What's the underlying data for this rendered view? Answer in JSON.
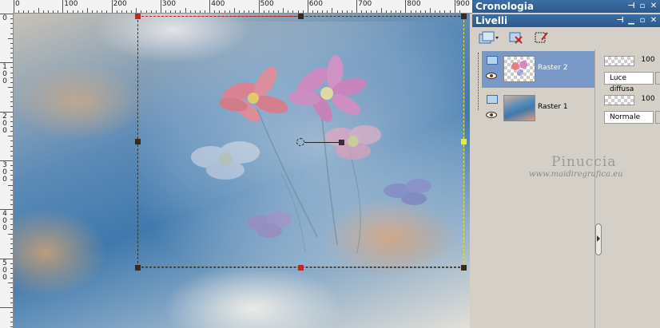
{
  "rulers": {
    "top_labels": [
      "0",
      "100",
      "200",
      "300",
      "400",
      "500",
      "600",
      "700",
      "800",
      "900"
    ],
    "left_labels": [
      [
        "0"
      ],
      [
        "1",
        "0",
        "0"
      ],
      [
        "2",
        "0",
        "0"
      ],
      [
        "3",
        "0",
        "0"
      ],
      [
        "4",
        "0",
        "0"
      ],
      [
        "5",
        "0",
        "0"
      ]
    ]
  },
  "panels": {
    "history_title": "Cronologia",
    "layers_title": "Livelli"
  },
  "layers": [
    {
      "name": "Raster 2",
      "opacity": "100",
      "blend": "Luce diffusa",
      "selected": true
    },
    {
      "name": "Raster 1",
      "opacity": "100",
      "blend": "Normale",
      "selected": false
    }
  ],
  "watermark": {
    "name": "Pinuccia",
    "url": "www.maidiregrafica.eu"
  },
  "colors": {
    "title_bar": "#3a6ea5",
    "selected_layer": "#7a98c6",
    "panel_bg": "#d4d0c8"
  },
  "icons": {
    "new_layer": "new-layer-icon",
    "delete_layer": "delete-layer-icon",
    "edit_selection": "edit-selection-icon",
    "visibility": "eye-icon"
  }
}
